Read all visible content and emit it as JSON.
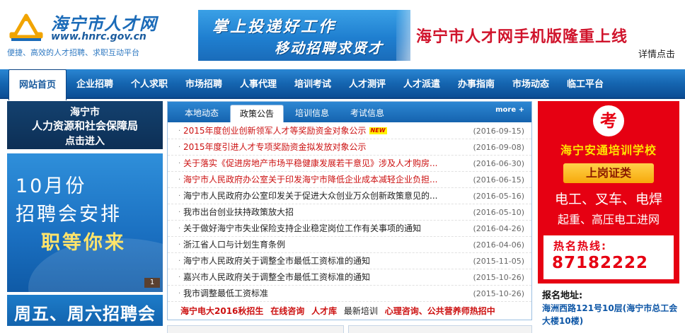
{
  "header": {
    "site_title": "海宁市人才网",
    "site_url": "www.hnrc.gov.cn",
    "slogan": "便捷、高效的人才招聘、求职互动平台",
    "banner": {
      "line1": "掌上投递好工作",
      "line2": "移动招聘求贤才",
      "mobile_text": "海宁市人才网手机版隆重上线",
      "detail_link": "详情点击"
    }
  },
  "nav": {
    "items": [
      {
        "label": "网站首页",
        "active": true
      },
      {
        "label": "企业招聘"
      },
      {
        "label": "个人求职"
      },
      {
        "label": "市场招聘"
      },
      {
        "label": "人事代理"
      },
      {
        "label": "培训考试"
      },
      {
        "label": "人才测评"
      },
      {
        "label": "人才派遣"
      },
      {
        "label": "办事指南"
      },
      {
        "label": "市场动态"
      },
      {
        "label": "临工平台"
      }
    ]
  },
  "left": {
    "bureau": {
      "city": "海宁市",
      "name": "人力资源和社会保障局",
      "enter": "点击进入"
    },
    "job_fair": {
      "line1": "10月份",
      "line2": "招聘会安排",
      "line3": "职等你来",
      "counter": "1"
    },
    "weekend": "周五、周六招聘会"
  },
  "news": {
    "tabs": [
      {
        "label": "本地动态"
      },
      {
        "label": "政策公告",
        "active": true
      },
      {
        "label": "培训信息"
      },
      {
        "label": "考试信息"
      }
    ],
    "more": "more +",
    "items": [
      {
        "title": "2015年度创业创新领军人才等奖励资金对象公示",
        "date": "(2016-09-15)",
        "red": true,
        "new": true
      },
      {
        "title": "2015年度引进人才专项奖励资金拟发放对象公示",
        "date": "(2016-09-08)",
        "red": true
      },
      {
        "title": "关于落实《促进房地产市场平稳健康发展若干意见》涉及人才购房...",
        "date": "(2016-06-30)",
        "red": true
      },
      {
        "title": "海宁市人民政府办公室关于印发海宁市降低企业成本减轻企业负担...",
        "date": "(2016-06-15)",
        "red": true
      },
      {
        "title": "海宁市人民政府办公室印发关于促进大众创业万众创新政策意见的...",
        "date": "(2016-05-16)"
      },
      {
        "title": "我市出台创业扶持政策放大招",
        "date": "(2016-05-10)"
      },
      {
        "title": "关于做好海宁市失业保险支持企业稳定岗位工作有关事项的通知",
        "date": "(2016-04-26)"
      },
      {
        "title": "浙江省人口与计划生育条例",
        "date": "(2016-04-06)"
      },
      {
        "title": "海宁市人民政府关于调整全市最低工资标准的通知",
        "date": "(2015-11-05)"
      },
      {
        "title": "嘉兴市人民政府关于调整全市最低工资标准的通知",
        "date": "(2015-10-26)"
      },
      {
        "title": "我市调整最低工资标准",
        "date": "(2015-10-26)"
      }
    ],
    "new_badge": "NEW",
    "quick_links": [
      {
        "label": "海宁电大2016秋招生",
        "style": "red"
      },
      {
        "label": "在线咨询",
        "style": "red"
      },
      {
        "label": "人才库",
        "style": "red"
      },
      {
        "label": "最新培训",
        "style": "dark"
      },
      {
        "label": "心理咨询、公共营养师热招中",
        "style": "red"
      }
    ]
  },
  "ad": {
    "logo_char": "考",
    "school": "海宁安通培训学校",
    "cert": "上岗证类",
    "line1": "电工、叉车、电焊",
    "line2": "起重、高压电工进网",
    "hotline_label": "热名热线:",
    "hotline_number": "87182222",
    "address_label": "报名地址:",
    "address_text": "海洲西路121号10层(海宁市总工会大楼10楼)"
  },
  "colors": {
    "brand_blue": "#1b6bb8",
    "nav_blue": "#1565b0",
    "accent_red": "#cc1111",
    "ad_red": "#e60012",
    "ad_yellow": "#ffe400"
  }
}
